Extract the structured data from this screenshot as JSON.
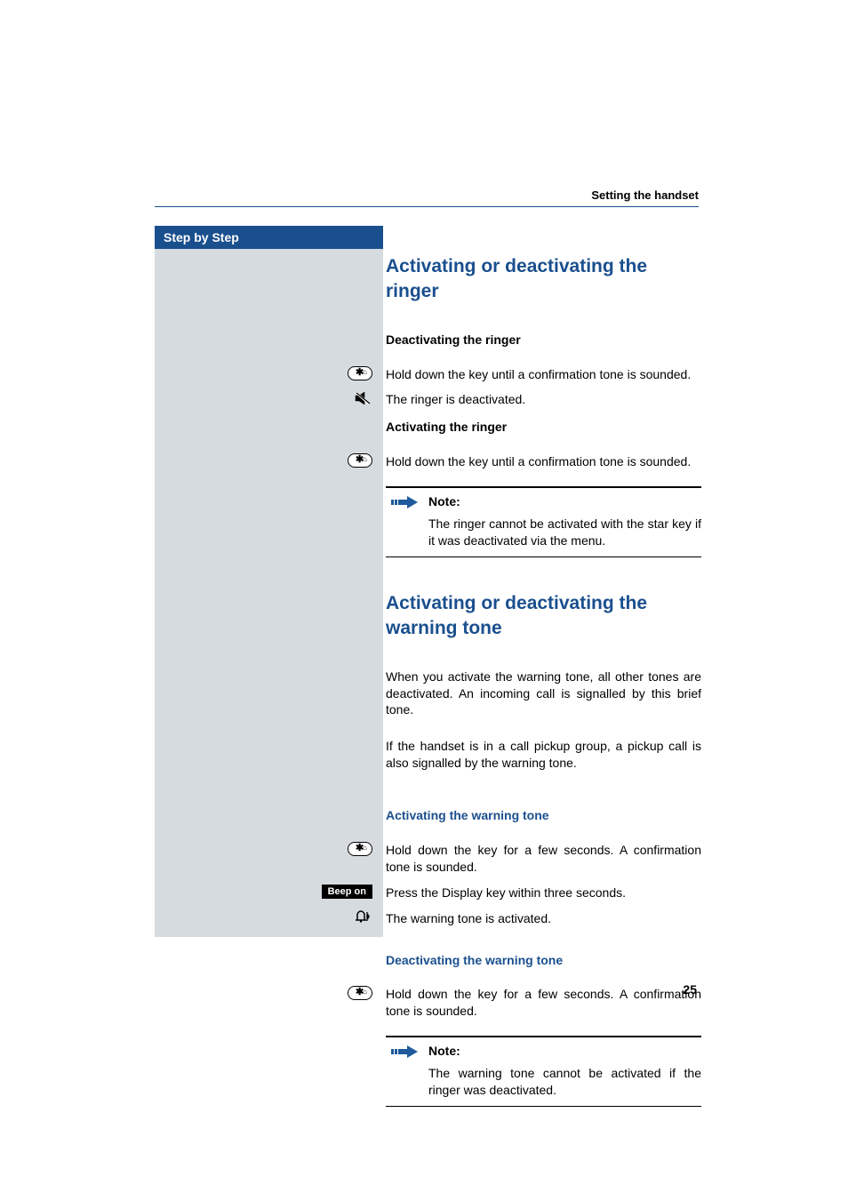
{
  "running_header": "Setting the handset",
  "sidebar_title": "Step by Step",
  "section1": {
    "heading": "Activating or deactivating the ringer",
    "deactivate_label": "Deactivating the ringer",
    "activate_label": "Activating the ringer",
    "hold_text": "Hold down the key until a confirmation tone is sounded.",
    "deactivated_text": "The ringer is deactivated.",
    "note_label": "Note:",
    "note_text": "The ringer cannot be activated with the star key if it was deactivated via the menu."
  },
  "section2": {
    "heading": "Activating or deactivating the warning tone",
    "intro1": "When you activate the warning tone, all other tones are deactivated. An incoming call is signalled by this brief tone.",
    "intro2": "If the handset is in a call pickup group, a pickup call is also signalled by the warning tone.",
    "activate_label": "Activating the warning tone",
    "hold_few_text": "Hold down the key for a few seconds. A confirmation tone is sounded.",
    "display_key_text": "Press the Display key within three seconds.",
    "display_key_label": "Beep on",
    "activated_text": "The warning tone is activated.",
    "deactivate_label": "Deactivating the warning tone",
    "note_label": "Note:",
    "note_text": "The warning tone cannot be activated if the ringer was deactivated."
  },
  "page_number": "25"
}
